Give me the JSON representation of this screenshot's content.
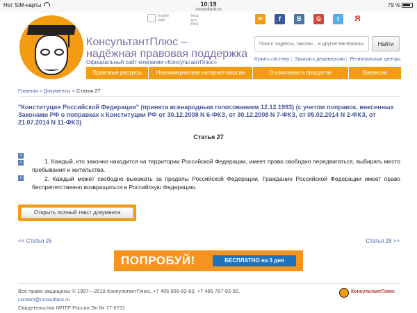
{
  "status": {
    "carrier": "Нет SIM-карты",
    "time": "10:19",
    "url": "consultant.ru",
    "battery": "79 %"
  },
  "header": {
    "brand_line1": "КонсультантПлюс –",
    "brand_line2": "надёжная правовая поддержка",
    "subtitle": "Официальный сайт компании «КонсультантПлюс»",
    "toplink_en": "English page",
    "toplink_rits": "Вход для РИЦ",
    "search_placeholder": "Поиск: кодексы, законы... и другие материалы",
    "search_button": "Найти",
    "action_buy": "Купить систему",
    "action_demo": "Заказать демоверсию",
    "action_regions": "Региональные центры",
    "social": [
      "✉",
      "f",
      "В",
      "G",
      "t",
      "Я"
    ]
  },
  "nav": [
    "Правовые ресурсы",
    "Некоммерческие интернет-версии",
    "О компании и продуктах",
    "Вакансии"
  ],
  "breadcrumb": {
    "home": "Главная",
    "sep": "»",
    "docs": "Документы",
    "current": "Статья 27"
  },
  "document": {
    "title": "\"Конституция Российской Федерации\" (принята всенародным голосованием 12.12.1993) (с учетом поправок, внесенных Законами РФ о поправках к Конституции РФ от 30.12.2008 N 6-ФКЗ, от 30.12.2008 N 7-ФКЗ, от 05.02.2014 N 2-ФКЗ, от 21.07.2014 N 11-ФКЗ)",
    "article": "Статья 27",
    "info_icon": "i",
    "para1": "1. Каждый, кто законно находится на территории Российской Федерации, имеет право свободно передвигаться, выбирать место пребывания и жительства.",
    "para2": "2. Каждый может свободно выезжать за пределы Российской Федерации. Гражданин Российской Федерации имеет право беспрепятственно возвращаться в Российскую Федерацию."
  },
  "open_button": "Открыть полный текст документа",
  "pager": {
    "prev": "<< Статья 26",
    "next": "Статья 28 >>"
  },
  "banner": {
    "big": "ПОПРОБУЙ!",
    "pill": "БЕСПЛАТНО на 3 дня"
  },
  "footer": {
    "line1": "Все права защищены © 1997—2018 КонсультантПлюс, +7 495 956-82-83, +7 495 787-92-92,",
    "email": "contact@consultant.ru",
    "line3": "Свидетельство МПТР России Эл № 77-6731",
    "brand": "КонсультантПлюс"
  },
  "colors": {
    "accent": "#f39c12",
    "link": "#4a62a8",
    "banner_pill": "#1e73be"
  }
}
